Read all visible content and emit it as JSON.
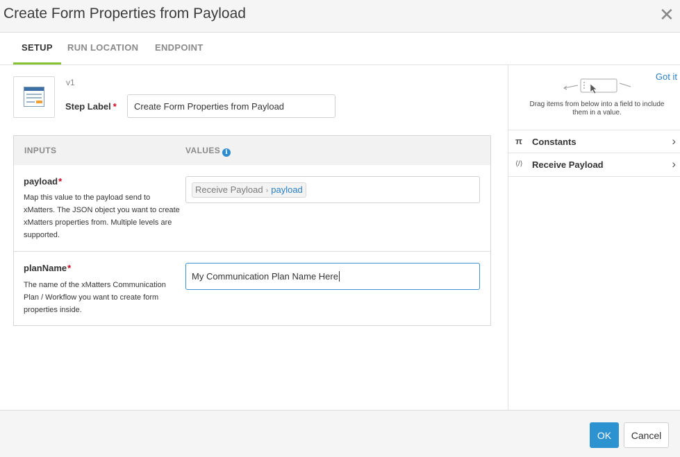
{
  "dialog": {
    "title": "Create Form Properties from Payload",
    "close_icon": "close-icon"
  },
  "tabs": [
    {
      "label": "SETUP",
      "active": true
    },
    {
      "label": "RUN LOCATION",
      "active": false
    },
    {
      "label": "ENDPOINT",
      "active": false
    }
  ],
  "step": {
    "icon": "form-step-icon",
    "version": "v1",
    "label_title": "Step Label",
    "required_mark": "*",
    "label_value": "Create Form Properties from Payload"
  },
  "table": {
    "col_inputs": "INPUTS",
    "col_values": "VALUES",
    "info_icon": "info-icon",
    "rows": [
      {
        "name": "payload",
        "required_mark": "*",
        "description": "Map this value to the payload send to xMatters. The JSON object you want to create xMatters properties from. Multiple levels are supported.",
        "value_source": "Receive Payload",
        "value_separator": "›",
        "value_leaf": "payload"
      },
      {
        "name": "planName",
        "required_mark": "*",
        "description": "The name of the xMatters Communication Plan / Workflow you want to create form properties inside.",
        "value_text": "My Communication Plan Name Here"
      }
    ]
  },
  "side_panel": {
    "got_it": "Got it",
    "hint": "Drag items from below into a field to include them in a value.",
    "items": [
      {
        "icon": "pi-icon",
        "glyph": "π",
        "label": "Constants"
      },
      {
        "icon": "code-icon",
        "glyph": "⟨/⟩",
        "label": "Receive Payload"
      }
    ]
  },
  "footer": {
    "ok_label": "OK",
    "cancel_label": "Cancel"
  },
  "colors": {
    "accent_tab": "#86c232",
    "primary_button": "#2d93d0",
    "link": "#2a7ec4",
    "required": "#d0021b"
  }
}
